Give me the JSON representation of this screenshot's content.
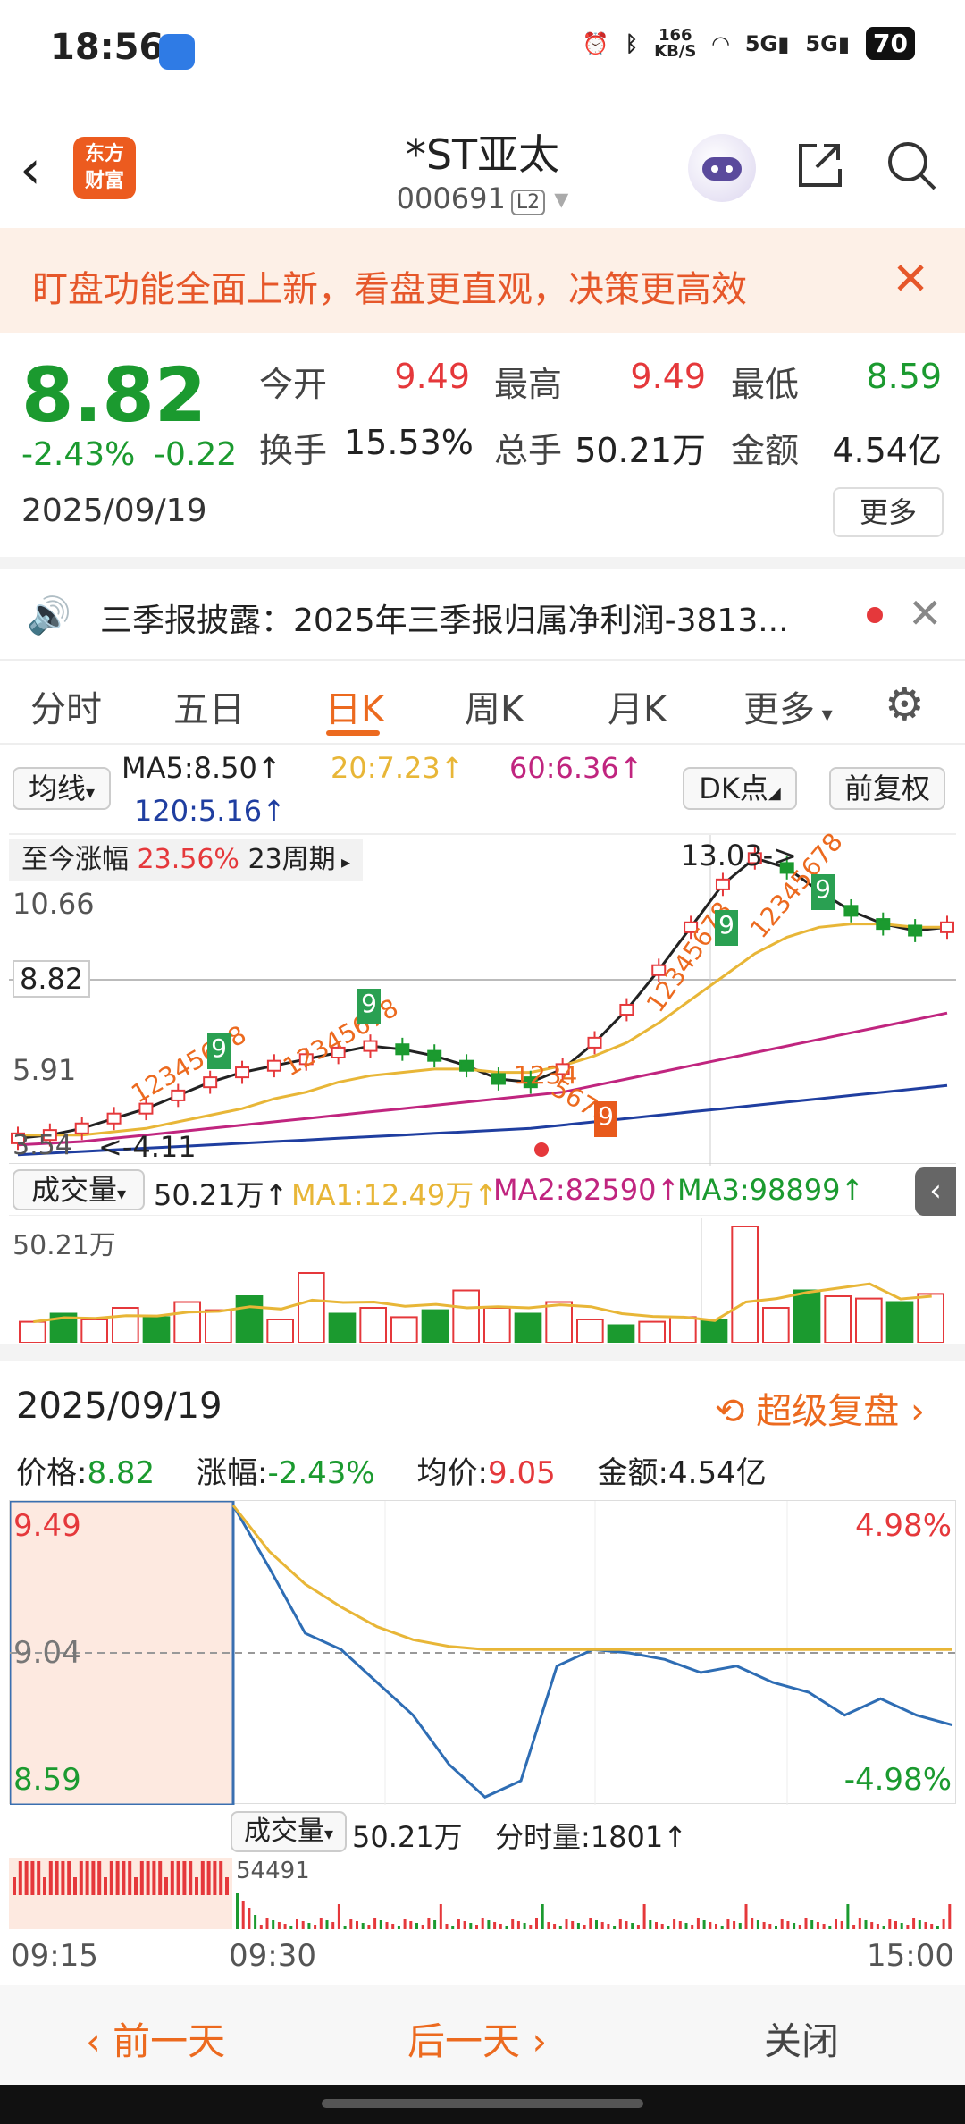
{
  "status_bar": {
    "time": "18:56",
    "net_speed": "166\nKB/S",
    "battery": "70"
  },
  "header": {
    "back_icon": "chevron-left-icon",
    "logo": "东方\n财富",
    "title": "*ST亚太",
    "code": "000691",
    "level": "L2"
  },
  "banner": {
    "text": "盯盘功能全面上新，看盘更直观，决策更高效"
  },
  "quote": {
    "price": "8.82",
    "change_pct": "-2.43%",
    "change": "-0.22",
    "date": "2025/09/19",
    "open_label": "今开",
    "open": "9.49",
    "high_label": "最高",
    "high": "9.49",
    "low_label": "最低",
    "low": "8.59",
    "turnover_label": "换手",
    "turnover": "15.53%",
    "volume_label": "总手",
    "volume": "50.21万",
    "amount_label": "金额",
    "amount": "4.54亿",
    "more_label": "更多"
  },
  "news": {
    "text": "三季报披露：2025年三季报归属净利润-3813..."
  },
  "tabs": [
    "分时",
    "五日",
    "日K",
    "周K",
    "月K",
    "更多"
  ],
  "ma_legend": {
    "selector": "均线",
    "ma5": "MA5:8.50↑",
    "ma20": "20:7.23↑",
    "ma60": "60:6.36↑",
    "ma120": "120:5.16↑",
    "dk": "DK点",
    "adjust": "前复权",
    "range_label": "至今涨幅",
    "range_pct": "23.56%",
    "range_period": "23周期"
  },
  "kline_labels": {
    "high_mark": "13.03->",
    "low_mark": "<-4.11",
    "y_top": "10.66",
    "y_current": "8.82",
    "y_mid": "5.91",
    "y_low": "3.54"
  },
  "td_sequences": [
    "12345678",
    "9",
    "12345678",
    "9",
    "12345678",
    "9",
    "12345678",
    "9",
    "1234",
    "5678",
    "9"
  ],
  "vol_legend": {
    "selector": "成交量",
    "vol": "50.21万↑",
    "ma1": "MA1:12.49万↑",
    "ma2": "MA2:82590↑",
    "ma3": "MA3:98899↑",
    "y_top": "50.21万"
  },
  "detail": {
    "date": "2025/09/19",
    "replay": "超级复盘",
    "price_label": "价格:",
    "price": "8.82",
    "pct_label": "涨幅:",
    "pct": "-2.43%",
    "avg_label": "均价:",
    "avg": "9.05",
    "amt_label": "金额:",
    "amt": "4.54亿"
  },
  "intraday": {
    "y_high": "9.49",
    "y_mid": "9.04",
    "y_low": "8.59",
    "pct_high": "4.98%",
    "pct_low": "-4.98%",
    "vol_selector": "成交量",
    "vol": "50.21万",
    "tick_vol": "分时量:1801↑",
    "vol_max": "54491",
    "t_start": "09:15",
    "t_open": "09:30",
    "t_end": "15:00"
  },
  "footer": {
    "prev": "前一天",
    "next": "后一天",
    "close": "关闭"
  },
  "chart_data": [
    {
      "type": "line",
      "title": "日K",
      "series": [
        {
          "name": "MA5",
          "values": [
            4.1,
            4.2,
            4.4,
            4.7,
            5.0,
            5.4,
            5.8,
            6.1,
            6.3,
            6.5,
            6.7,
            6.9,
            6.8,
            6.6,
            6.3,
            5.9,
            5.8,
            6.2,
            7.0,
            8.0,
            9.2,
            10.5,
            11.8,
            12.6,
            12.3,
            11.6,
            11.0,
            10.6,
            10.4,
            10.5
          ]
        },
        {
          "name": "20",
          "values": [
            4.2,
            4.2,
            4.2,
            4.3,
            4.4,
            4.6,
            4.8,
            5.0,
            5.3,
            5.5,
            5.8,
            6.0,
            6.1,
            6.2,
            6.2,
            6.1,
            6.1,
            6.3,
            6.6,
            7.0,
            7.6,
            8.3,
            9.0,
            9.7,
            10.2,
            10.5,
            10.6,
            10.6,
            10.5,
            10.5
          ]
        },
        {
          "name": "60",
          "values": [
            3.9,
            3.95,
            4.0,
            4.1,
            4.2,
            4.3,
            4.4,
            4.5,
            4.6,
            4.7,
            4.8,
            4.9,
            5.0,
            5.1,
            5.2,
            5.3,
            5.4,
            5.5,
            5.7,
            5.9,
            6.1,
            6.3,
            6.5,
            6.7,
            6.9,
            7.1,
            7.3,
            7.5,
            7.7,
            7.9
          ]
        },
        {
          "name": "120",
          "values": [
            3.6,
            3.65,
            3.7,
            3.75,
            3.8,
            3.85,
            3.9,
            3.95,
            4.0,
            4.05,
            4.1,
            4.15,
            4.2,
            4.25,
            4.3,
            4.35,
            4.4,
            4.5,
            4.6,
            4.7,
            4.8,
            4.9,
            5.0,
            5.1,
            5.2,
            5.3,
            5.4,
            5.5,
            5.6,
            5.7
          ]
        }
      ],
      "ylim": [
        3.54,
        13.03
      ]
    },
    {
      "type": "bar",
      "title": "成交量",
      "values": [
        18,
        25,
        20,
        30,
        22,
        35,
        28,
        40,
        20,
        60,
        25,
        30,
        22,
        28,
        45,
        30,
        25,
        35,
        20,
        15,
        18,
        22,
        20,
        100,
        30,
        45,
        40,
        38,
        35,
        42
      ]
    },
    {
      "type": "line",
      "title": "分时",
      "series": [
        {
          "name": "价格",
          "values": [
            9.49,
            9.3,
            9.1,
            9.05,
            8.95,
            8.85,
            8.7,
            8.6,
            8.65,
            9.0,
            9.05,
            9.04,
            9.02,
            8.98,
            9.0,
            8.95,
            8.92,
            8.85,
            8.9,
            8.85,
            8.82
          ]
        },
        {
          "name": "均价",
          "values": [
            9.49,
            9.35,
            9.25,
            9.18,
            9.12,
            9.08,
            9.06,
            9.05,
            9.05,
            9.05,
            9.05,
            9.05,
            9.05,
            9.05,
            9.05,
            9.05,
            9.05,
            9.05,
            9.05,
            9.05,
            9.05
          ]
        }
      ],
      "ylim": [
        8.59,
        9.49
      ]
    }
  ]
}
